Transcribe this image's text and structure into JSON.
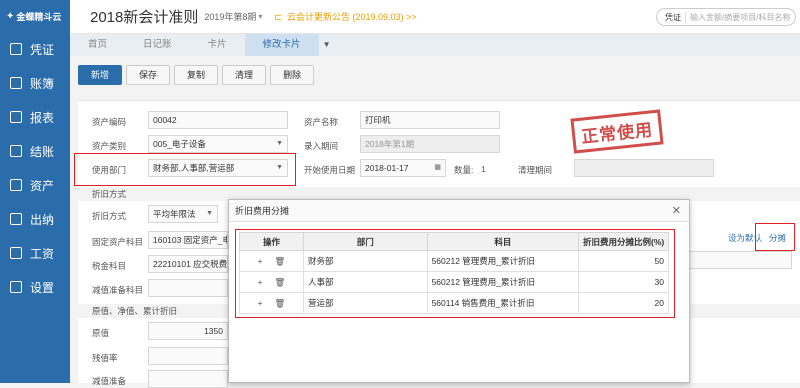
{
  "app": {
    "logo": "金蝶精斗云",
    "book": "2018新会计准则",
    "period": "2019年第8期",
    "notice": "云会计更新公告 (2019.09.03) >>"
  },
  "search": {
    "scope": "凭证",
    "placeholder": "输入金额/摘要项目/科目名称"
  },
  "sidebar": {
    "items": [
      {
        "label": "凭证",
        "icon": "voucher-icon"
      },
      {
        "label": "账簿",
        "icon": "ledger-icon"
      },
      {
        "label": "报表",
        "icon": "report-icon"
      },
      {
        "label": "结账",
        "icon": "close-account-icon"
      },
      {
        "label": "资产",
        "icon": "asset-icon"
      },
      {
        "label": "出纳",
        "icon": "cashier-icon"
      },
      {
        "label": "工资",
        "icon": "payroll-icon"
      },
      {
        "label": "设置",
        "icon": "settings-icon"
      }
    ]
  },
  "tabs": [
    "首页",
    "日记账",
    "卡片",
    "修改卡片"
  ],
  "toolbar": {
    "new": "新增",
    "save": "保存",
    "copy": "复制",
    "clear": "清理",
    "delete": "删除"
  },
  "form": {
    "asset_code_label": "资产编码",
    "asset_code": "00042",
    "asset_name_label": "资产名称",
    "asset_name": "打印机",
    "asset_type_label": "资产类别",
    "asset_type": "005_电子设备",
    "entry_period_label": "录入期间",
    "entry_period": "2018年第1期",
    "dept_label": "使用部门",
    "dept": "财务部,人事部,营运部",
    "start_date_label": "开始使用日期",
    "start_date": "2018-01-17",
    "qty_label": "数量:",
    "qty": "1",
    "clear_period_label": "清理期间",
    "depr_section": "折旧方式",
    "depr_method_label": "折旧方式",
    "depr_method": "平均年限法",
    "fixed_acct_label": "固定资产科目",
    "fixed_acct": "160103 固定资产_电",
    "tax_acct_label": "税金科目",
    "tax_acct": "22210101 应交税费_",
    "impair_label": "减值准备科目",
    "value_section": "原值、净值、累计折旧",
    "orig_label": "原值",
    "orig": "1350",
    "residual_label": "残值率",
    "impair2_label": "减值准备",
    "stamp": "正常使用",
    "set_default": "设为默认",
    "split": "分摊"
  },
  "dialog": {
    "title": "折旧费用分摊",
    "headers": [
      "操作",
      "部门",
      "科目",
      "折旧费用分摊比例(%)"
    ],
    "rows": [
      {
        "dept": "财务部",
        "account": "560212 管理费用_累计折旧",
        "ratio": "50"
      },
      {
        "dept": "人事部",
        "account": "560212 管理费用_累计折旧",
        "ratio": "30"
      },
      {
        "dept": "营运部",
        "account": "560114 销售费用_累计折旧",
        "ratio": "20"
      }
    ]
  }
}
